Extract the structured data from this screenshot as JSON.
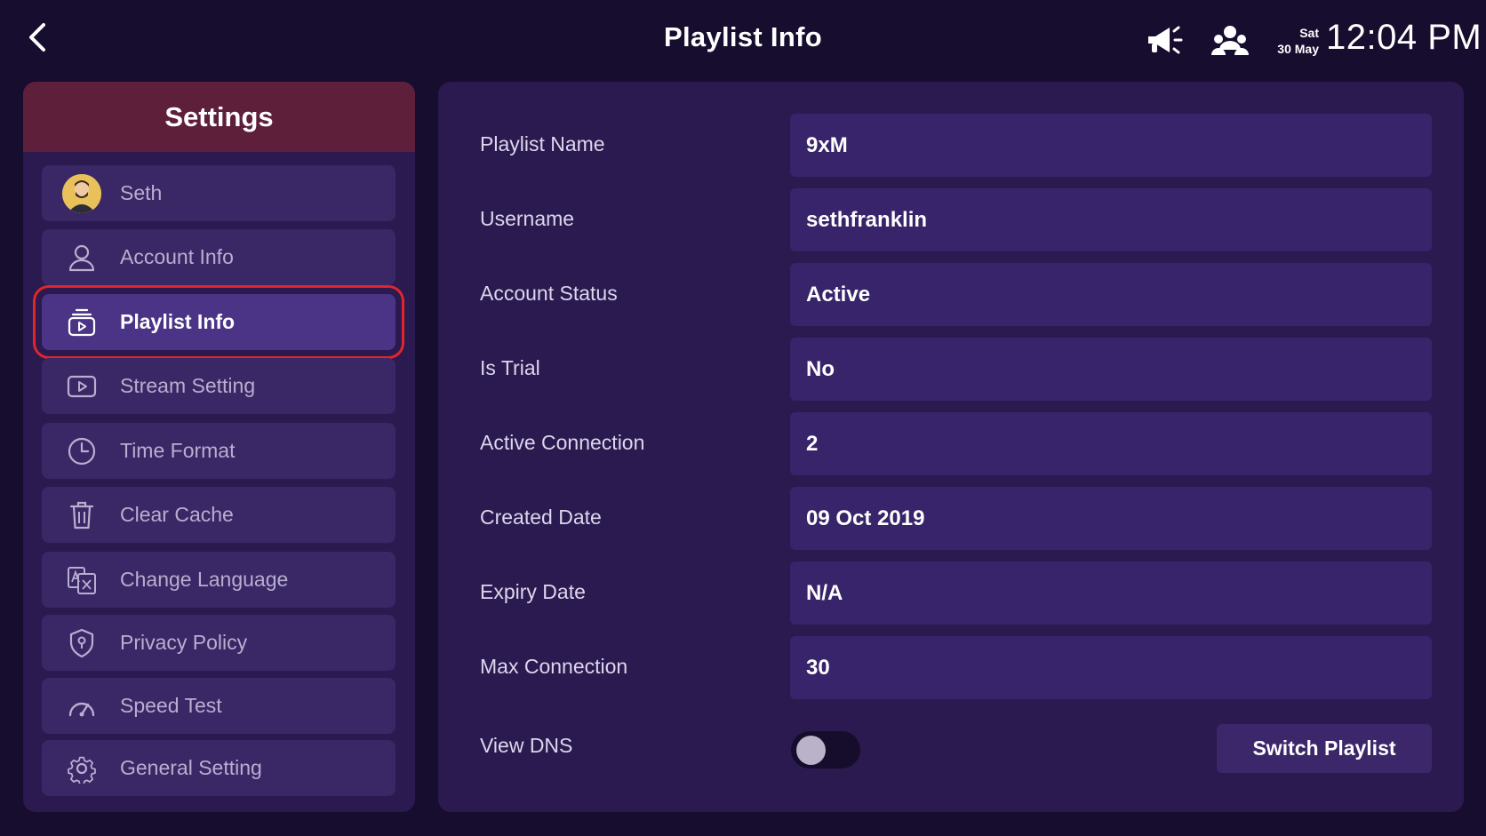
{
  "header": {
    "title": "Playlist Info",
    "back_icon": "chevron-left-icon",
    "announce_icon": "megaphone-icon",
    "users_icon": "user-group-icon",
    "day": "Sat",
    "date": "30 May",
    "time": "12:04 PM"
  },
  "sidebar": {
    "title": "Settings",
    "items": [
      {
        "label": "Seth",
        "icon": "avatar"
      },
      {
        "label": "Account Info",
        "icon": "user-icon"
      },
      {
        "label": "Playlist Info",
        "icon": "playlist-icon",
        "active": true
      },
      {
        "label": "Stream Setting",
        "icon": "play-box-icon"
      },
      {
        "label": "Time Format",
        "icon": "clock-icon"
      },
      {
        "label": "Clear Cache",
        "icon": "trash-icon"
      },
      {
        "label": "Change Language",
        "icon": "translate-icon"
      },
      {
        "label": "Privacy Policy",
        "icon": "shield-icon"
      },
      {
        "label": "Speed Test",
        "icon": "speedometer-icon"
      },
      {
        "label": "General Setting",
        "icon": "gear-icon"
      }
    ]
  },
  "info": {
    "rows": [
      {
        "label": "Playlist Name",
        "value": "9xM"
      },
      {
        "label": "Username",
        "value": "sethfranklin"
      },
      {
        "label": "Account Status",
        "value": "Active"
      },
      {
        "label": "Is Trial",
        "value": "No"
      },
      {
        "label": "Active Connection",
        "value": "2"
      },
      {
        "label": "Created Date",
        "value": "09 Oct 2019"
      },
      {
        "label": "Expiry Date",
        "value": "N/A"
      },
      {
        "label": "Max Connection",
        "value": "30"
      }
    ],
    "view_dns_label": "View DNS",
    "view_dns_enabled": false,
    "switch_label": "Switch Playlist"
  },
  "colors": {
    "background": "#170d2e",
    "panel": "#2a1a4f",
    "sidebar_header": "#5e1f3b",
    "active_outline": "#e0262a"
  }
}
